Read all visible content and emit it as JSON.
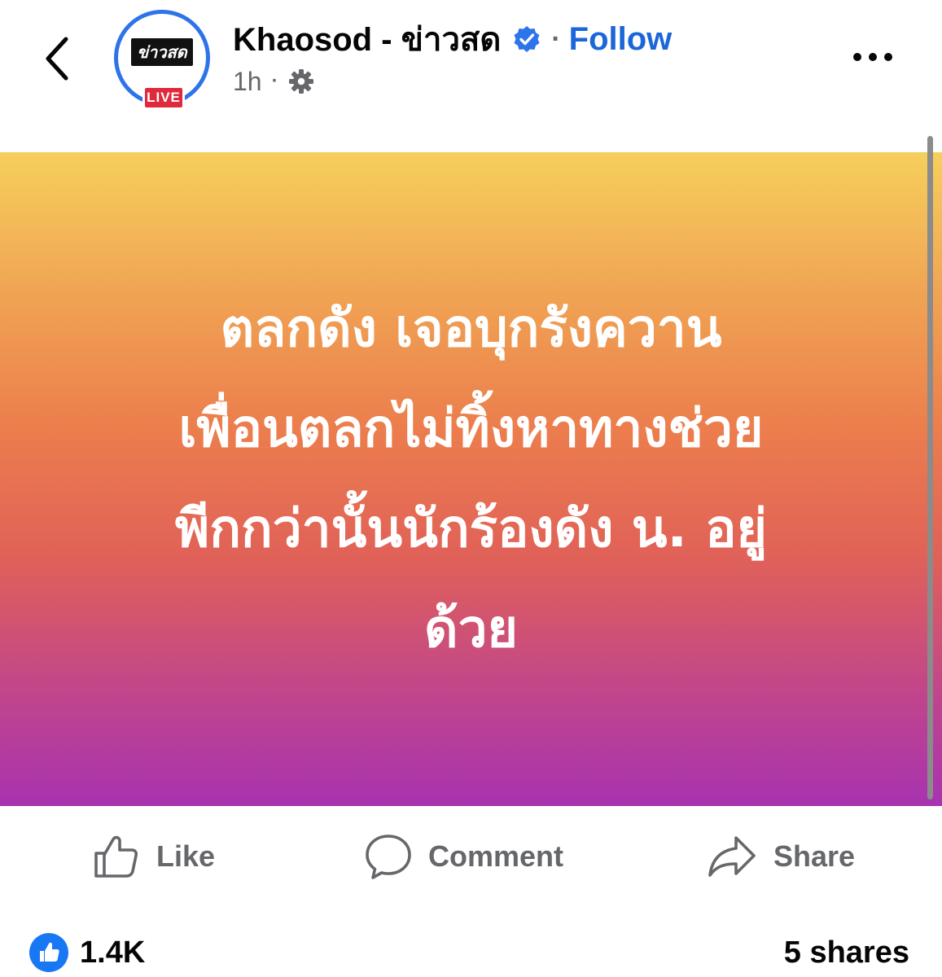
{
  "header": {
    "page_name": "Khaosod - ข่าวสด",
    "follow_label": "Follow",
    "separator": "·",
    "time": "1h",
    "avatar_logo_text": "ข่าวสด",
    "live_badge": "LIVE",
    "icons": {
      "back": "chevron-left-icon",
      "verified": "verified-badge-icon",
      "audience": "gear-icon",
      "more": "more-dots-icon"
    }
  },
  "post": {
    "lines": [
      "ตลกดัง เจอบุกรังควาน",
      "เพื่อนตลกไม่ทิ้งหาทางช่วย",
      "พีกกว่านั้นนักร้องดัง น. อยู่",
      "ด้วย"
    ],
    "gradient_colors": [
      "#f6cf5c",
      "#ec7e4d",
      "#a733b0"
    ]
  },
  "actions": {
    "like_label": "Like",
    "comment_label": "Comment",
    "share_label": "Share"
  },
  "footer": {
    "reaction_count": "1.4K",
    "shares_text": "5 shares"
  },
  "colors": {
    "accent": "#1b66d9",
    "verified": "#2d73ea",
    "live": "#e0293a",
    "muted_text": "#65676b"
  }
}
